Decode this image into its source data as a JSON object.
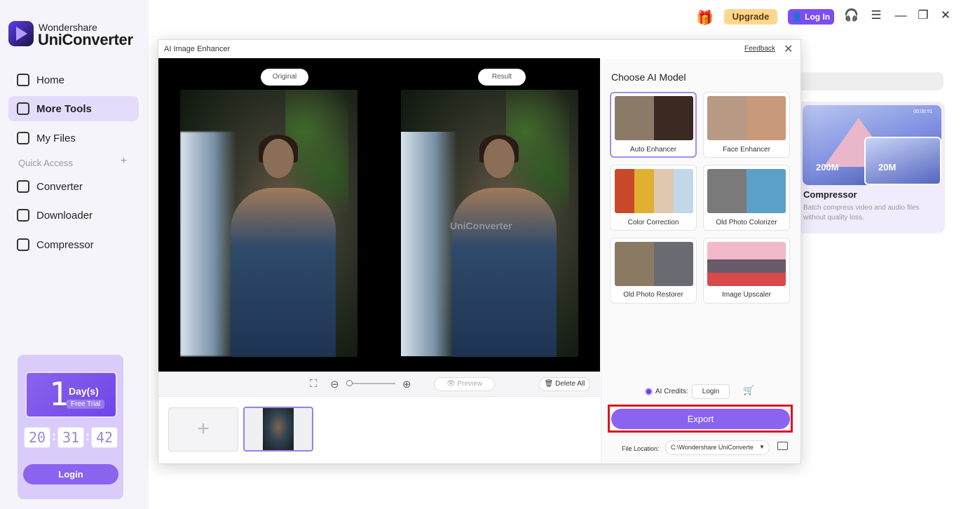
{
  "app": {
    "brand_top": "Wondershare",
    "brand_name": "UniConverter",
    "accent": "#8a63ee"
  },
  "sidebar": {
    "items": [
      {
        "label": "Home",
        "icon": "home-icon"
      },
      {
        "label": "More Tools",
        "icon": "toolbox-icon",
        "active": true
      },
      {
        "label": "My Files",
        "icon": "file-icon"
      }
    ],
    "quick_access_label": "Quick Access",
    "quick_items": [
      {
        "label": "Converter",
        "icon": "converter-icon"
      },
      {
        "label": "Downloader",
        "icon": "downloader-icon"
      },
      {
        "label": "Compressor",
        "icon": "compressor-icon"
      }
    ]
  },
  "trial": {
    "days": "1",
    "days_label": "Day(s)",
    "free_trial": "Free Trial",
    "hours": "20",
    "minutes": "31",
    "seconds": "42",
    "login_label": "Login"
  },
  "topbar": {
    "upgrade": "Upgrade",
    "login": "Log In"
  },
  "background_card": {
    "from_size": "200M",
    "to_size": "20M",
    "duration": "00:00:51",
    "title": "Compressor",
    "description": "Batch compress video and audio files without quality loss."
  },
  "dialog": {
    "title": "AI Image Enhancer",
    "feedback": "Feedback",
    "original_label": "Original",
    "result_label": "Result",
    "watermark": "UniConverter",
    "preview_label": "Preview",
    "delete_all_label": "Delete All"
  },
  "models": {
    "heading": "Choose AI Model",
    "items": [
      {
        "label": "Auto Enhancer",
        "selected": true
      },
      {
        "label": "Face Enhancer"
      },
      {
        "label": "Color Correction"
      },
      {
        "label": "Old Photo Colorizer"
      },
      {
        "label": "Old Photo Restorer"
      },
      {
        "label": "Image Upscaler"
      }
    ]
  },
  "export": {
    "credits_label": "AI Credits:",
    "credits_login": "Login",
    "export_label": "Export",
    "file_location_label": "File Location:",
    "file_location_value": "C:\\Wondershare UniConverte"
  }
}
